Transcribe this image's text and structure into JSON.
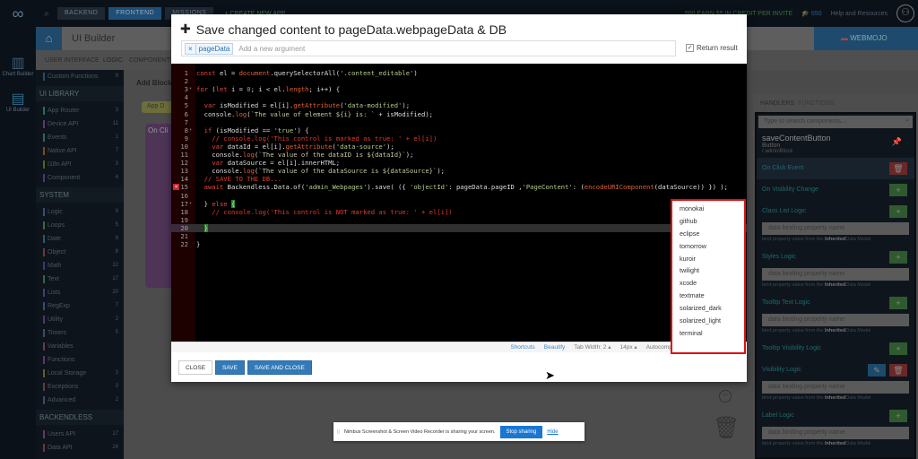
{
  "topbar": {
    "backend": "BACKEND",
    "frontend": "FRONTEND",
    "missions": "MISSIONS",
    "create": "+ CREATE NEW APP",
    "credit": "500 EARN $5 IN CREDIT PER INVITE",
    "points": "650",
    "help": "Help and Resources"
  },
  "iconcol": [
    {
      "label": "Chart Builder"
    },
    {
      "label": "UI Builder"
    }
  ],
  "header": {
    "title": "UI Builder",
    "app": "WEBMOJO",
    "tabs": [
      "USER INTERFACE",
      "LOGIC",
      "COMPONENTS"
    ]
  },
  "sidebar": {
    "top": {
      "label": "Custom Functions",
      "count": "9"
    },
    "sections": [
      {
        "title": "UI LIBRARY",
        "items": [
          {
            "label": "App Router",
            "count": "3",
            "color": "#2a6a6a"
          },
          {
            "label": "Device API",
            "count": "11",
            "color": "#5a3a7a"
          },
          {
            "label": "Events",
            "count": "1",
            "color": "#2a6a5a"
          },
          {
            "label": "Native API",
            "count": "7",
            "color": "#7a4a1a"
          },
          {
            "label": "I18n API",
            "count": "3",
            "color": "#4a6a1a"
          },
          {
            "label": "Component",
            "count": "4",
            "color": "#4a3a6a"
          }
        ]
      },
      {
        "title": "SYSTEM",
        "items": [
          {
            "label": "Logic",
            "count": "9",
            "color": "#3a4a7a"
          },
          {
            "label": "Loops",
            "count": "5",
            "color": "#3a6a3a"
          },
          {
            "label": "Date",
            "count": "9",
            "color": "#2a5a6a"
          },
          {
            "label": "Object",
            "count": "8",
            "color": "#6a3a3a"
          },
          {
            "label": "Math",
            "count": "12",
            "color": "#3a3a7a"
          },
          {
            "label": "Text",
            "count": "17",
            "color": "#2a6a4a"
          },
          {
            "label": "Lists",
            "count": "20",
            "color": "#4a3a7a"
          },
          {
            "label": "RegExp",
            "count": "7",
            "color": "#3a4a7a"
          },
          {
            "label": "Utility",
            "count": "2",
            "color": "#4a3a6a"
          },
          {
            "label": "Timers",
            "count": "5",
            "color": "#3a4a6a"
          },
          {
            "label": "Variables",
            "count": "",
            "color": "#6a3a4a"
          },
          {
            "label": "Functions",
            "count": "",
            "color": "#5a3a6a"
          },
          {
            "label": "Local Storage",
            "count": "3",
            "color": "#6a5a2a"
          },
          {
            "label": "Exceptions",
            "count": "3",
            "color": "#6a3a3a"
          },
          {
            "label": "Advanced",
            "count": "2",
            "color": "#3a4a6a"
          }
        ]
      },
      {
        "title": "BACKENDLESS",
        "items": [
          {
            "label": "Users API",
            "count": "17",
            "color": "#6a3a5a"
          },
          {
            "label": "Data API",
            "count": "24",
            "color": "#6a3a3a"
          }
        ]
      }
    ]
  },
  "canvas": {
    "add_block": "Add Block:",
    "app_block": "App D",
    "on_click": "On Cli"
  },
  "panel": {
    "tabs": [
      "HANDLERS",
      "FUNCTIONS"
    ],
    "search_placeholder": "Type to search components...",
    "component": "saveContentButton",
    "type": "Button",
    "path": "/ adminBlock",
    "hint_prefix": "bind property value from the ",
    "hint_bold": "Inherited",
    "hint_suffix": "Data Model",
    "input_placeholder": "data binding property name",
    "handlers": [
      {
        "name": "On Click Event",
        "btn": "del",
        "input": false,
        "sel": true
      },
      {
        "name": "On Visibility Change",
        "btn": "add",
        "input": false
      },
      {
        "name": "Class List Logic",
        "btn": "add",
        "input": true
      },
      {
        "name": "Styles Logic",
        "btn": "add",
        "input": true
      },
      {
        "name": "Tooltip Text Logic",
        "btn": "add",
        "input": true
      },
      {
        "name": "Tooltip Visibility Logic",
        "btn": "add",
        "input": false
      },
      {
        "name": "Visibility Logic",
        "btn": "editdel",
        "input": true
      },
      {
        "name": "Label Logic",
        "btn": "add",
        "input": true
      }
    ]
  },
  "modal": {
    "title": "Save changed content to pageData.webpageData & DB",
    "argument": "pageData",
    "arg_placeholder": "Add a new argument",
    "return_result": "Return result",
    "code": [
      [
        [
          "kw",
          "const"
        ],
        [
          "pl",
          " el = "
        ],
        [
          "fn",
          "document"
        ],
        [
          "pl",
          "."
        ],
        [
          "pl",
          "querySelectorAll("
        ],
        [
          "str",
          "'.content_editable'"
        ],
        [
          "pl",
          ")"
        ]
      ],
      [],
      [
        [
          "kw",
          "for"
        ],
        [
          "pl",
          " ("
        ],
        [
          "kw",
          "let"
        ],
        [
          "pl",
          " i = "
        ],
        [
          "num",
          "0"
        ],
        [
          "pl",
          "; i < el."
        ],
        [
          "fn",
          "length"
        ],
        [
          "pl",
          "; i++) {"
        ]
      ],
      [],
      [
        [
          "pl",
          "  "
        ],
        [
          "kw",
          "var"
        ],
        [
          "pl",
          " isModified = el[i]."
        ],
        [
          "fn",
          "getAttribute"
        ],
        [
          "pl",
          "("
        ],
        [
          "str",
          "'data-modified'"
        ],
        [
          "pl",
          ");"
        ]
      ],
      [
        [
          "pl",
          "  console."
        ],
        [
          "fn",
          "log"
        ],
        [
          "pl",
          "("
        ],
        [
          "tpl",
          "`The value of element ${i} is: `"
        ],
        [
          "pl",
          " + isModified);"
        ]
      ],
      [],
      [
        [
          "pl",
          "  "
        ],
        [
          "kw",
          "if"
        ],
        [
          "pl",
          " (isModified == "
        ],
        [
          "str",
          "'true'"
        ],
        [
          "pl",
          ") {"
        ]
      ],
      [
        [
          "cmt",
          "    // console.log('This control is marked as true: ' + el[i])"
        ]
      ],
      [
        [
          "pl",
          "    "
        ],
        [
          "kw",
          "var"
        ],
        [
          "pl",
          " dataId = el[i]."
        ],
        [
          "fn",
          "getAttribute"
        ],
        [
          "pl",
          "("
        ],
        [
          "str",
          "'data-source'"
        ],
        [
          "pl",
          ");"
        ]
      ],
      [
        [
          "pl",
          "    console."
        ],
        [
          "fn",
          "log"
        ],
        [
          "pl",
          "("
        ],
        [
          "tpl",
          "`The value of the dataID is ${dataId}`"
        ],
        [
          "pl",
          ");"
        ]
      ],
      [
        [
          "pl",
          "    "
        ],
        [
          "kw",
          "var"
        ],
        [
          "pl",
          " dataSource = el[i].innerHTML;"
        ]
      ],
      [
        [
          "pl",
          "    console."
        ],
        [
          "fn",
          "log"
        ],
        [
          "pl",
          "("
        ],
        [
          "tpl",
          "`The value of the dataSource is ${dataSource}`"
        ],
        [
          "pl",
          ");"
        ]
      ],
      [
        [
          "cmt",
          "  // SAVE TO THE DB..."
        ]
      ],
      [
        [
          "pl",
          "  "
        ],
        [
          "kw",
          "await"
        ],
        [
          "pl",
          " Backendless.Data.of("
        ],
        [
          "str",
          "'admin_Webpages'"
        ],
        [
          "pl",
          ").save( ({ "
        ],
        [
          "str",
          "'objectId'"
        ],
        [
          "pl",
          ": pageData.pageID ,"
        ],
        [
          "str",
          "'PageContent'"
        ],
        [
          "pl",
          ": ("
        ],
        [
          "fn",
          "encodeURIComponent"
        ],
        [
          "pl",
          "(dataSource)) }) );"
        ]
      ],
      [],
      [
        [
          "pl",
          "  } "
        ],
        [
          "kw",
          "else"
        ],
        [
          "pl",
          " "
        ],
        [
          "br",
          "{"
        ]
      ],
      [
        [
          "cmt",
          "    // console.log('This control is NOT marked as true: ' + el[i])"
        ]
      ],
      [],
      [
        [
          "pl",
          "  "
        ],
        [
          "br",
          "}"
        ]
      ],
      [],
      [
        [
          "pl",
          "}"
        ]
      ]
    ],
    "folds": [
      3,
      8,
      17
    ],
    "error_line": 15,
    "active_line": 20,
    "status": {
      "shortcuts": "Shortcuts",
      "beautify": "Beautify",
      "tab_width": "Tab Width: 2 ▴",
      "font_size": "14px ▴",
      "autocomplete": "Autocompletion: On ▴",
      "theme": "terminal ▴"
    },
    "buttons": {
      "close": "CLOSE",
      "save": "SAVE",
      "save_close": "SAVE AND CLOSE"
    },
    "themes": [
      "monokai",
      "github",
      "eclipse",
      "tomorrow",
      "kuroir",
      "twilight",
      "xcode",
      "textmate",
      "solarized_dark",
      "solarized_light",
      "terminal"
    ]
  },
  "share": {
    "text": "Nimbus Screenshot & Screen Video Recorder is sharing your screen.",
    "stop": "Stop sharing",
    "hide": "Hide"
  }
}
